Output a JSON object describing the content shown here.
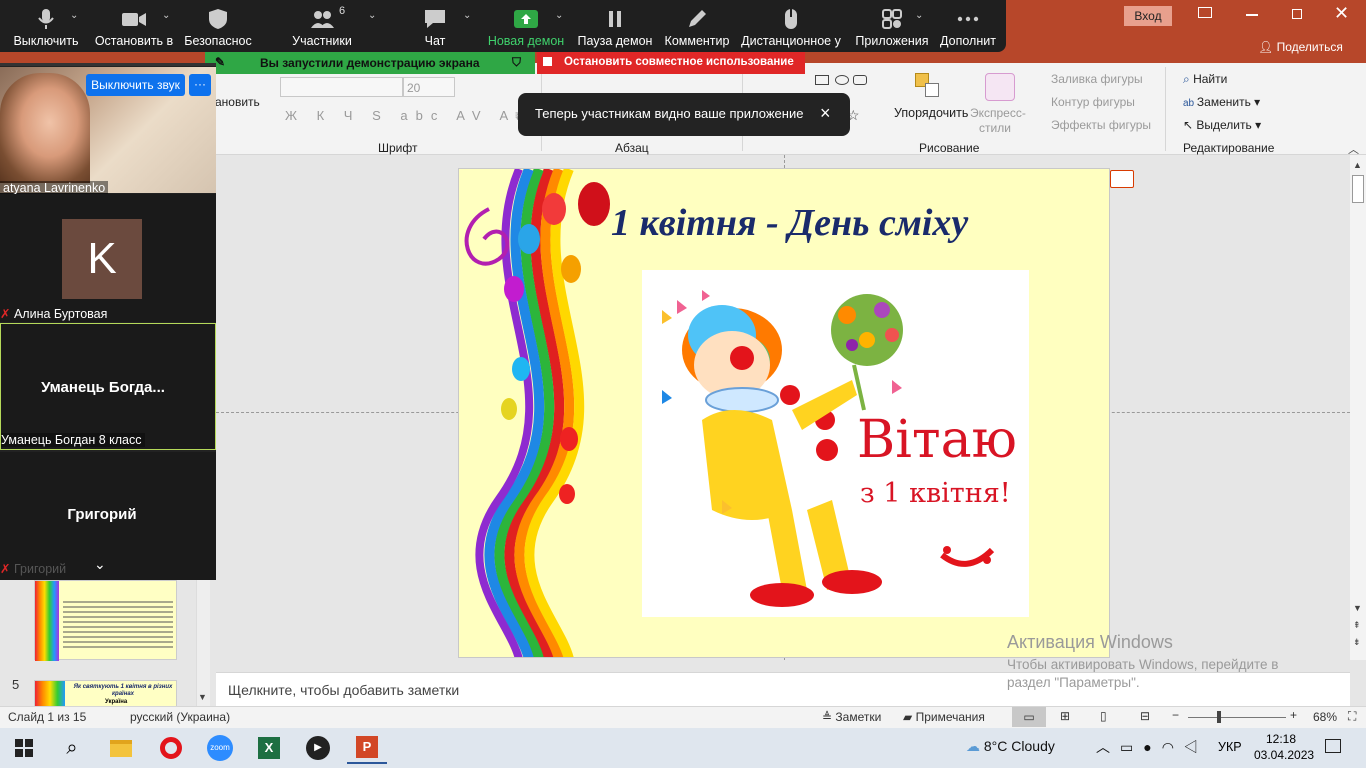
{
  "ribbon_top": {
    "sign_in": "Вход",
    "share": "Поделиться"
  },
  "zoom_toolbar": {
    "mute": "Выключить",
    "stop_video": "Остановить в",
    "security": "Безопаснос",
    "participants": "Участники",
    "participants_count": "6",
    "chat": "Чат",
    "new_share": "Новая демон",
    "pause_share": "Пауза демон",
    "annotate": "Комментир",
    "remote_control": "Дистанционное у",
    "apps": "Приложения",
    "more": "Дополнит"
  },
  "share_banner": {
    "text": "Вы запустили демонстрацию экрана",
    "stop": "Остановить совместное использование"
  },
  "toast": {
    "text": "Теперь участникам видно ваше приложение",
    "close": "×"
  },
  "ribbon": {
    "partial_label": "ановить",
    "font_size": "20",
    "groups": {
      "font": "Шрифт",
      "paragraph": "Абзац",
      "drawing": "Рисование",
      "editing": "Редактирование"
    },
    "arrange": "Упорядочить",
    "quick_styles_1": "Экспресс-",
    "quick_styles_2": "стили",
    "shape_fill": "Заливка фигуры",
    "shape_outline": "Контур фигуры",
    "shape_effects": "Эффекты фигуры",
    "find": "Найти",
    "replace": "Заменить",
    "select": "Выделить"
  },
  "gallery": {
    "mute_btn": "Выключить звук",
    "more_btn": "···",
    "tile1_name": "atyana Lavrinenko",
    "tile2_initial": "K",
    "tile2_name": "Алина Буртовая",
    "tile3_center": "Уманець  Богда...",
    "tile3_name": "Уманець Богдан 8 класс",
    "tile4_center": "Григорий",
    "tile4_name": "Григорий"
  },
  "thumbs": {
    "slide5_num": "5",
    "slide5_title": "Як святкують 1 квітня в різних країнах",
    "slide5_sub": "Україна"
  },
  "slide": {
    "title": "1 квітня - День сміху",
    "greet_1": "Вітаю",
    "greet_2": "з 1 квітня!"
  },
  "notes": {
    "placeholder": "Щелкните, чтобы добавить заметки"
  },
  "watermark": {
    "title": "Активация Windows",
    "line1": "Чтобы активировать Windows, перейдите в",
    "line2": "раздел \"Параметры\"."
  },
  "status": {
    "slide": "Слайд 1 из 15",
    "language": "русский (Украина)",
    "notes": "Заметки",
    "comments": "Примечания",
    "zoom": "68%"
  },
  "taskbar": {
    "weather": "8°C  Cloudy",
    "lang": "УКР",
    "time": "12:18",
    "date": "03.04.2023",
    "zoom_app": "zoom"
  },
  "colors": {
    "ppt_red": "#b7472a",
    "share_green": "#2fa745",
    "stop_red": "#e02727",
    "title_navy": "#1a2b6b",
    "slide_bg": "#ffffc0"
  }
}
